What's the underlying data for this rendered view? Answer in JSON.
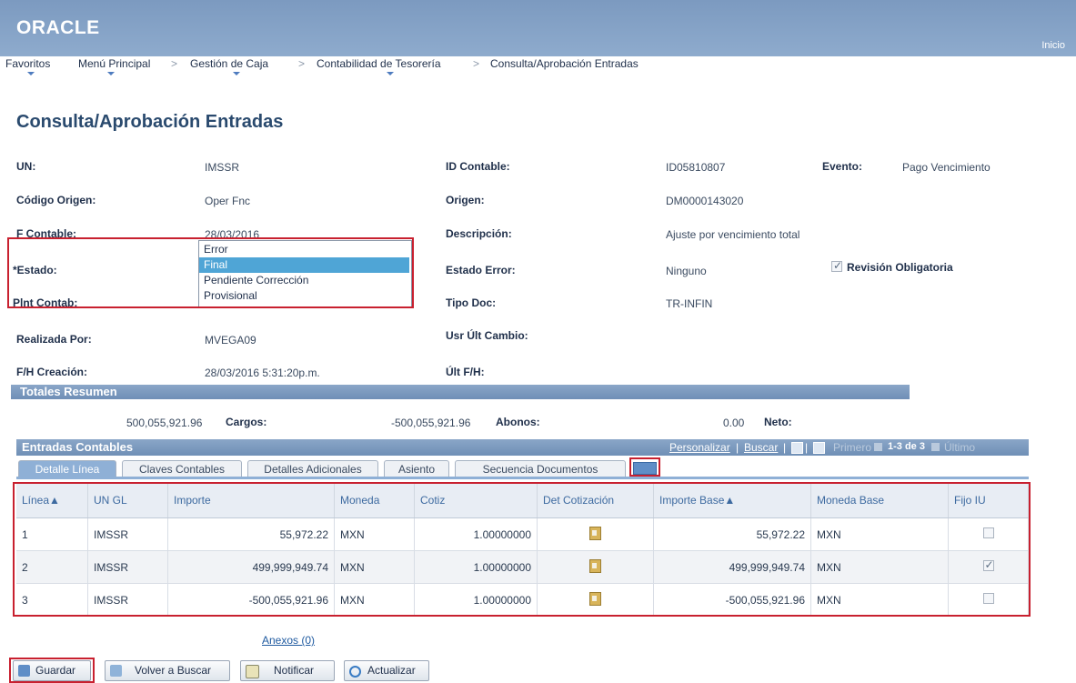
{
  "header": {
    "logo": "ORACLE",
    "home": "Inicio"
  },
  "breadcrumb": [
    "Favoritos",
    "Menú Principal",
    "Gestión de Caja",
    "Contabilidad de Tesorería",
    "Consulta/Aprobación Entradas"
  ],
  "page_title": "Consulta/Aprobación Entradas",
  "fields": {
    "un_label": "UN:",
    "un_value": "IMSSR",
    "codigo_label": "Código Origen:",
    "codigo_value": "Oper Fnc",
    "fcontable_label": "F Contable:",
    "fcontable_value": "28/03/2016",
    "estado_label": "*Estado:",
    "plnt_label": "Plnt Contab:",
    "realizada_label": "Realizada Por:",
    "realizada_value": "MVEGA09",
    "fh_label": "F/H Creación:",
    "fh_value": "28/03/2016  5:31:20p.m.",
    "idcontable_label": "ID Contable:",
    "idcontable_value": "ID05810807",
    "evento_label": "Evento:",
    "evento_value": "Pago Vencimiento",
    "origen_label": "Origen:",
    "origen_value": "DM0000143020",
    "descripcion_label": "Descripción:",
    "descripcion_value": "Ajuste por vencimiento total",
    "estadoerror_label": "Estado Error:",
    "estadoerror_value": "Ninguno",
    "revision_label": "Revisión Obligatoria",
    "tipodoc_label": "Tipo Doc:",
    "tipodoc_value": "TR-INFIN",
    "usr_label": "Usr Últ Cambio:",
    "ultfh_label": "Últ F/H:"
  },
  "status_dropdown": {
    "options": [
      "Error",
      "Final",
      "Pendiente Corrección",
      "Provisional"
    ],
    "selected": "Final"
  },
  "totals": {
    "title": "Totales Resumen",
    "cargos_value": "500,055,921.96",
    "cargos_label": "Cargos:",
    "abonos_value": "-500,055,921.96",
    "abonos_label": "Abonos:",
    "neto_value": "0.00",
    "neto_label": "Neto:"
  },
  "grid": {
    "title": "Entradas Contables",
    "personalizar": "Personalizar",
    "sep": "|",
    "buscar": "Buscar",
    "primero": "Primero",
    "range": "1-3 de 3",
    "ultimo": "Último",
    "tabs": [
      "Detalle Línea",
      "Claves Contables",
      "Detalles Adicionales",
      "Asiento",
      "Secuencia Documentos"
    ],
    "columns": [
      "Línea▲",
      "UN GL",
      "Importe",
      "Moneda",
      "Cotiz",
      "Det Cotización",
      "Importe Base▲",
      "Moneda Base",
      "Fijo IU"
    ],
    "rows": [
      {
        "linea": "1",
        "ungl": "IMSSR",
        "importe": "55,972.22",
        "moneda": "MXN",
        "cotiz": "1.00000000",
        "importe_base": "55,972.22",
        "moneda_base": "MXN",
        "fijo": false
      },
      {
        "linea": "2",
        "ungl": "IMSSR",
        "importe": "499,999,949.74",
        "moneda": "MXN",
        "cotiz": "1.00000000",
        "importe_base": "499,999,949.74",
        "moneda_base": "MXN",
        "fijo": true
      },
      {
        "linea": "3",
        "ungl": "IMSSR",
        "importe": "-500,055,921.96",
        "moneda": "MXN",
        "cotiz": "1.00000000",
        "importe_base": "-500,055,921.96",
        "moneda_base": "MXN",
        "fijo": false
      }
    ]
  },
  "annexes": "Anexos (0)",
  "buttons": {
    "guardar": "Guardar",
    "volver": "Volver a Buscar",
    "notificar": "Notificar",
    "actualizar": "Actualizar"
  },
  "colors": {
    "accent": "#7c9ac0",
    "highlight": "#c8202f",
    "selected_option": "#4fa5d6"
  }
}
